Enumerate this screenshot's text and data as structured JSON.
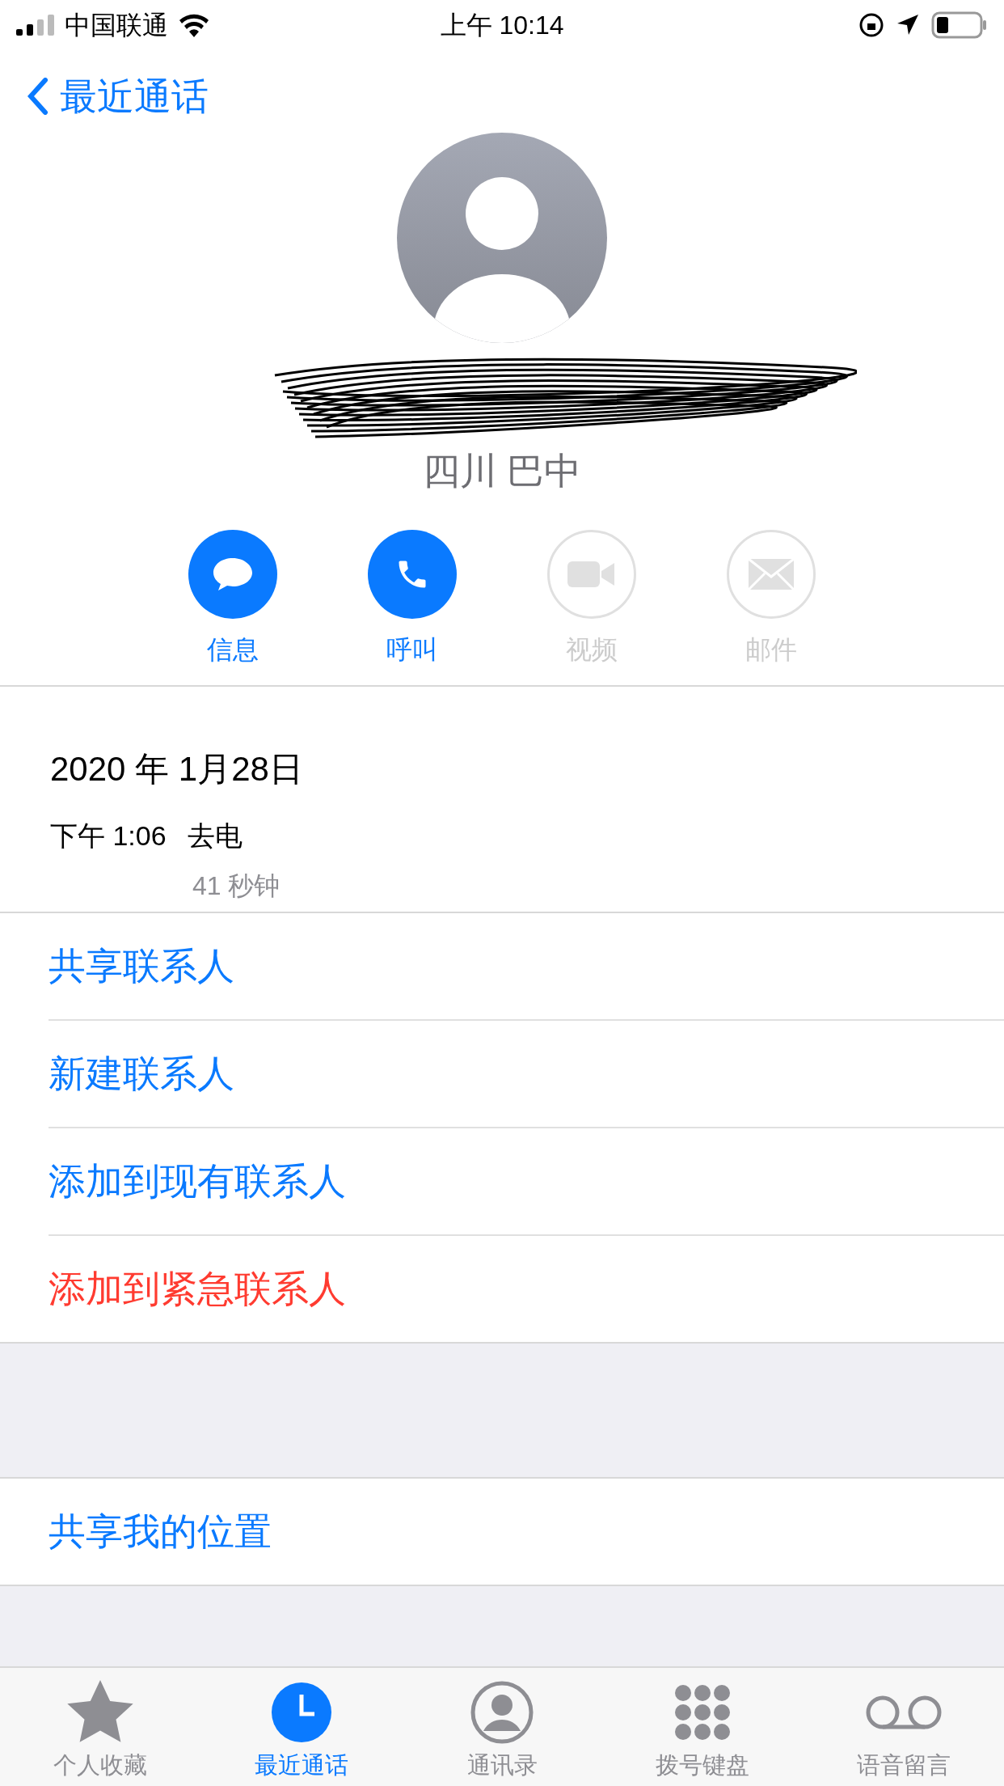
{
  "status_bar": {
    "carrier": "中国联通",
    "time": "上午 10:14"
  },
  "nav": {
    "back": "最近通话"
  },
  "contact": {
    "location": "四川 巴中"
  },
  "actions": [
    {
      "kind": "message",
      "label": "信息",
      "disabled": false
    },
    {
      "kind": "call",
      "label": "呼叫",
      "disabled": false
    },
    {
      "kind": "video",
      "label": "视频",
      "disabled": true
    },
    {
      "kind": "mail",
      "label": "邮件",
      "disabled": true
    }
  ],
  "call_log": {
    "date": "2020 年 1月28日",
    "time": "下午 1:06",
    "type": "去电",
    "duration": "41 秒钟"
  },
  "menu": [
    {
      "label": "共享联系人",
      "destructive": false
    },
    {
      "label": "新建联系人",
      "destructive": false
    },
    {
      "label": "添加到现有联系人",
      "destructive": false
    },
    {
      "label": "添加到紧急联系人",
      "destructive": true
    }
  ],
  "share_location": "共享我的位置",
  "tabs": [
    {
      "kind": "favorites",
      "label": "个人收藏",
      "selected": false
    },
    {
      "kind": "recents",
      "label": "最近通话",
      "selected": true
    },
    {
      "kind": "contacts",
      "label": "通讯录",
      "selected": false
    },
    {
      "kind": "keypad",
      "label": "拨号键盘",
      "selected": false
    },
    {
      "kind": "voicemail",
      "label": "语音留言",
      "selected": false
    }
  ]
}
